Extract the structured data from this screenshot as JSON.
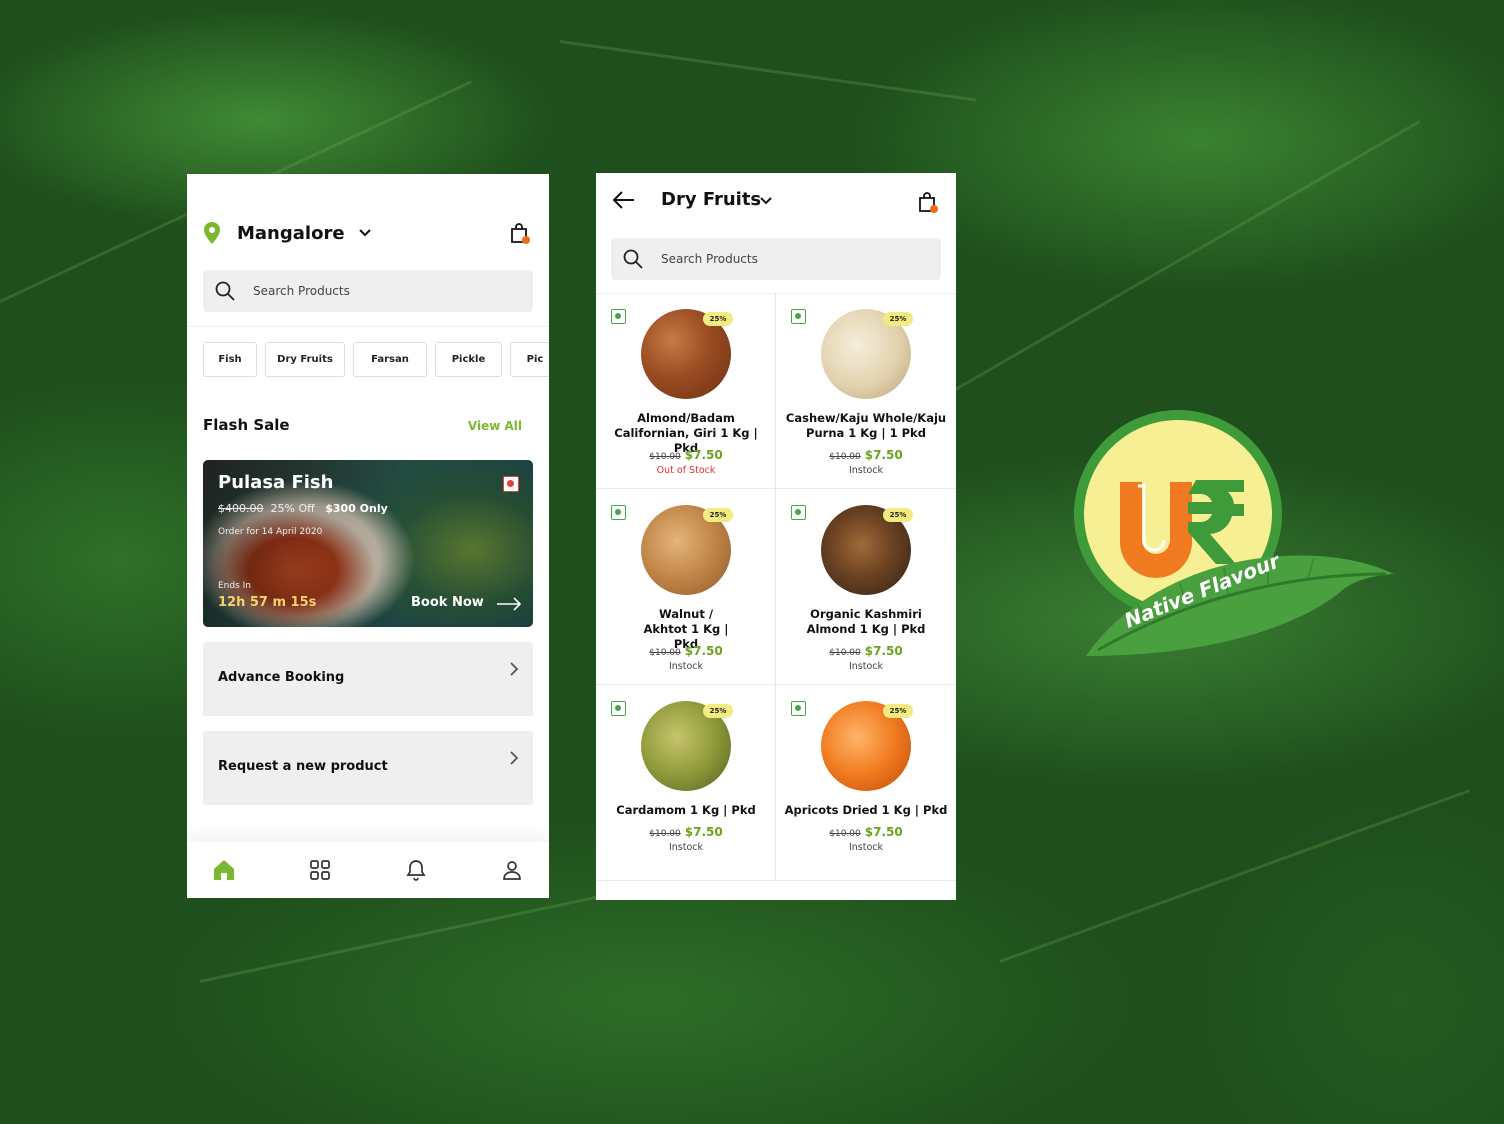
{
  "colors": {
    "brand_green": "#7cb82f",
    "accent_orange": "#f06a1c",
    "price_green": "#6aa31c",
    "out_of_stock": "#e0312d"
  },
  "home": {
    "location": "Mangalore",
    "search_placeholder": "Search Products",
    "categories": [
      "Fish",
      "Dry Fruits",
      "Farsan",
      "Pickle",
      "Pic"
    ],
    "flash_sale": {
      "title": "Flash Sale",
      "view_all": "View All",
      "product": "Pulasa Fish",
      "old_price": "$400.00",
      "discount": "25% Off",
      "offer": "$300 Only",
      "order_for": "Order for 14 April 2020",
      "ends_in_label": "Ends In",
      "timer": "12h 57 m 15s",
      "cta": "Book Now"
    },
    "menu": [
      {
        "label": "Advance Booking"
      },
      {
        "label": "Request a new product"
      }
    ],
    "tabs": [
      "home-icon",
      "grid-icon",
      "bell-icon",
      "user-icon"
    ]
  },
  "catalog": {
    "title": "Dry Fruits",
    "search_placeholder": "Search Products",
    "products": [
      {
        "name": "Almond/Badam Californian, Giri 1 Kg | Pkd",
        "badge": "25%",
        "old_price": "$10.00",
        "price": "$7.50",
        "stock": "Out of Stock"
      },
      {
        "name": "Cashew/Kaju Whole/Kaju Purna  1 Kg | 1 Pkd",
        "badge": "25%",
        "old_price": "$10.00",
        "price": "$7.50",
        "stock": "Instock"
      },
      {
        "name": "Walnut / Akhtot 1 Kg | Pkd",
        "badge": "25%",
        "old_price": "$10.00",
        "price": "$7.50",
        "stock": "Instock"
      },
      {
        "name": "Organic Kashmiri Almond 1 Kg | Pkd",
        "badge": "25%",
        "old_price": "$10.00",
        "price": "$7.50",
        "stock": "Instock"
      },
      {
        "name": "Cardamom 1 Kg | Pkd",
        "badge": "25%",
        "old_price": "$10.00",
        "price": "$7.50",
        "stock": "Instock"
      },
      {
        "name": "Apricots Dried  1 Kg | Pkd",
        "badge": "25%",
        "old_price": "$10.00",
        "price": "$7.50",
        "stock": "Instock"
      }
    ]
  },
  "logo": {
    "tagline": "Native Flavour"
  }
}
